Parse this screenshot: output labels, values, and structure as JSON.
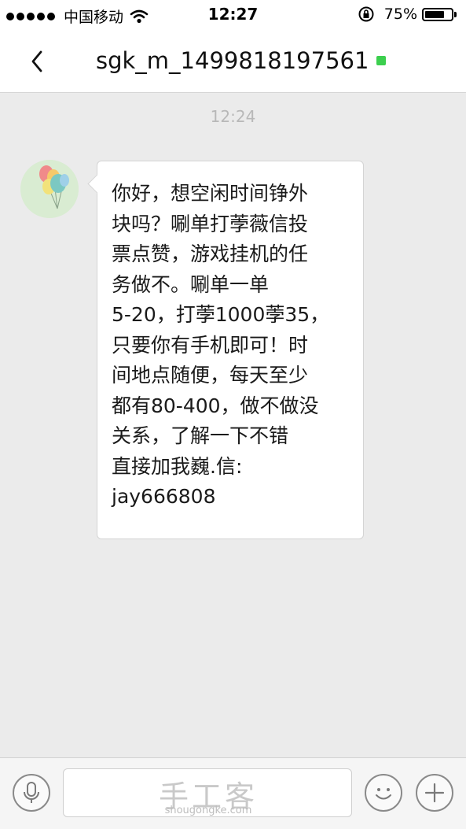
{
  "status_bar": {
    "carrier": "中国移动",
    "time": "12:27",
    "battery_percent": "75%",
    "battery_level": 0.75,
    "signal_icon": "signal-dots-icon",
    "wifi_icon": "wifi-icon",
    "lock_icon": "rotation-lock-icon"
  },
  "nav": {
    "back_icon": "chevron-left-icon",
    "title": "sgk_m_1499818197561",
    "online_color": "#3ccf4e"
  },
  "chat": {
    "timestamp": "12:24",
    "messages": [
      {
        "sender_avatar": "balloons-avatar",
        "text": "你好，想空闲时间铮外\n块吗？唰单打荸薇信投\n票点赞，游戏挂机的任\n务做不。唰单一单\n5-20，打荸1000荸35，\n只要你有手机即可！时\n间地点随便，每天至少\n都有80-400，做不做没\n关系，了解一下不错\n直接加我巍.信:\njay666808"
      }
    ]
  },
  "input_bar": {
    "voice_icon": "microphone-icon",
    "emoji_icon": "smiley-icon",
    "more_icon": "plus-icon",
    "watermark_main": "手工客",
    "watermark_sub": "shougongke.com"
  },
  "colors": {
    "background": "#ebebeb",
    "bubble": "#ffffff",
    "accent_online": "#3ccf4e"
  }
}
